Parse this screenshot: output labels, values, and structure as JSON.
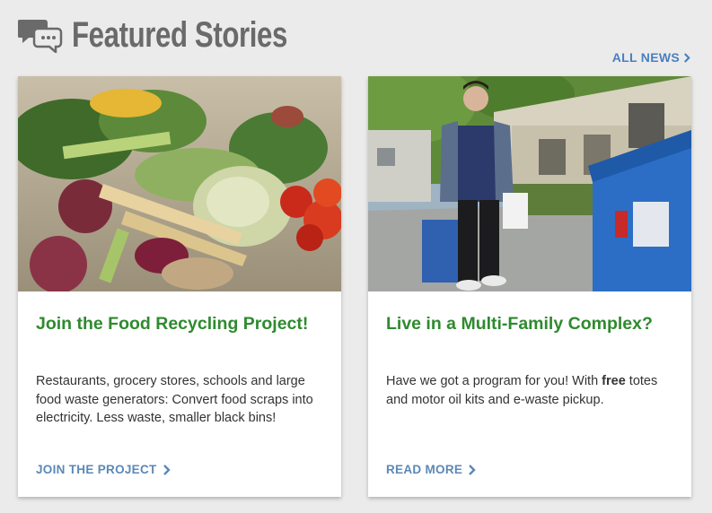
{
  "header": {
    "title": "Featured Stories",
    "icon": "speech-bubbles-icon",
    "all_news_label": "ALL NEWS",
    "all_news_arrow": "chevron-right-icon"
  },
  "cards": [
    {
      "image_alt": "food-scraps-photo",
      "title": "Join the Food Recycling Project!",
      "body": "Restaurants, grocery stores, schools and large food waste generators: Convert food scraps into electricity. Less waste, smaller black bins!",
      "link_label": "JOIN THE PROJECT"
    },
    {
      "image_alt": "man-carrying-recycling-photo",
      "title": "Live in a Multi-Family Complex?",
      "body_before": "Have we got a program for you! With ",
      "body_bold": "free",
      "body_after": " totes and motor oil kits and e-waste pickup.",
      "link_label": "READ MORE"
    }
  ],
  "colors": {
    "background": "#ebebeb",
    "title_green": "#2f8a2f",
    "link_blue": "#5b88b7",
    "header_gray": "#6a6a6a"
  }
}
